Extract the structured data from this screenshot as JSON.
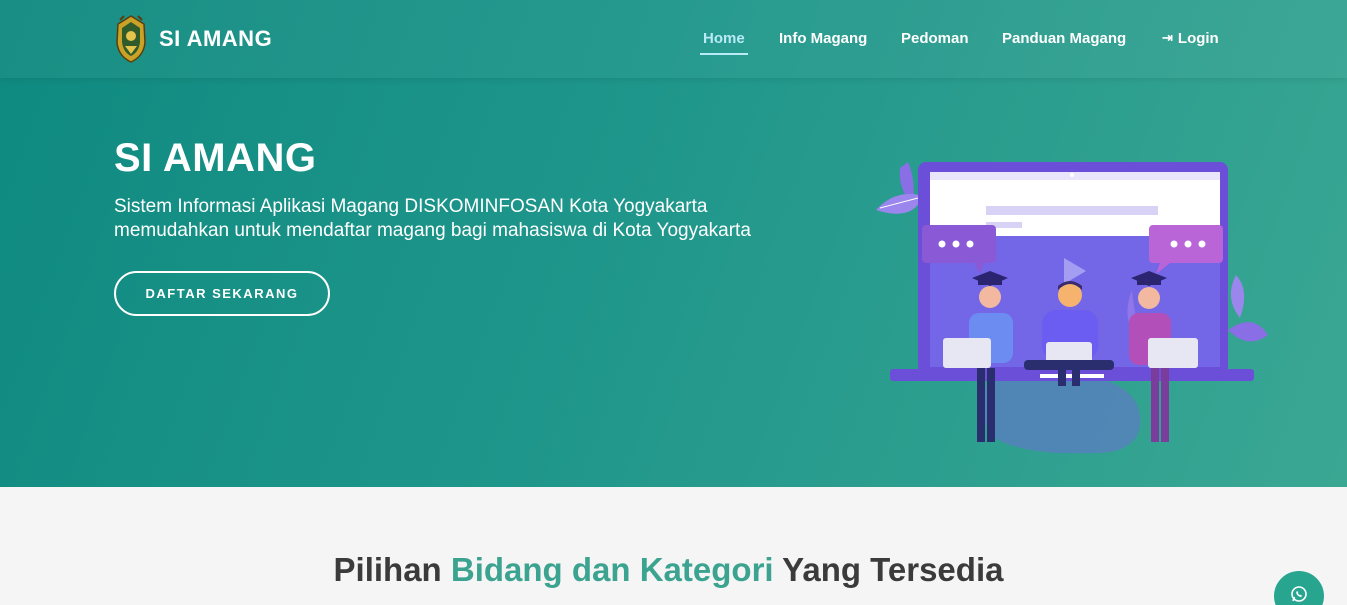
{
  "brand": {
    "name": "SI AMANG",
    "logo_icon": "yogyakarta-crest-icon"
  },
  "nav": {
    "items": [
      {
        "label": "Home",
        "active": true
      },
      {
        "label": "Info Magang",
        "active": false
      },
      {
        "label": "Pedoman",
        "active": false
      },
      {
        "label": "Panduan Magang",
        "active": false
      },
      {
        "label": "Login",
        "active": false,
        "icon": "login-icon"
      }
    ]
  },
  "hero": {
    "title": "SI AMANG",
    "description_line1": "Sistem Informasi Aplikasi Magang DISKOMINFOSAN Kota Yogyakarta",
    "description_line2": "memudahkan untuk mendaftar magang bagi mahasiswa di Kota Yogyakarta",
    "cta_label": "DAFTAR SEKARANG",
    "illustration_icon": "online-learning-illustration"
  },
  "section": {
    "title_prefix": "Pilihan ",
    "title_accent": "Bidang dan Kategori",
    "title_suffix": " Yang Tersedia"
  },
  "floating": {
    "icon": "whatsapp-icon"
  },
  "colors": {
    "primary": "#1f968b",
    "accent": "#3ba38f",
    "active_nav": "#b9eaf7",
    "illustration": "#6b4fd8"
  }
}
